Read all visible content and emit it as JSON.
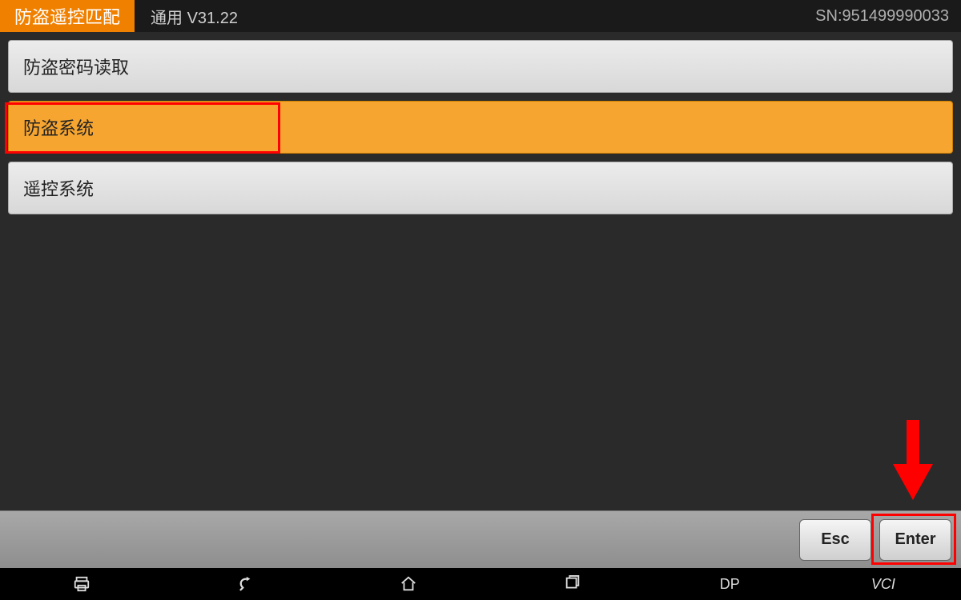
{
  "header": {
    "title": "防盗遥控匹配",
    "version": "通用  V31.22",
    "sn": "SN:951499990033"
  },
  "menu": {
    "items": [
      {
        "label": "防盗密码读取",
        "selected": false
      },
      {
        "label": "防盗系统",
        "selected": true
      },
      {
        "label": "遥控系统",
        "selected": false
      }
    ]
  },
  "footer": {
    "esc_label": "Esc",
    "enter_label": "Enter"
  },
  "nav": {
    "dp_label": "DP",
    "vci_label": "VCI"
  }
}
